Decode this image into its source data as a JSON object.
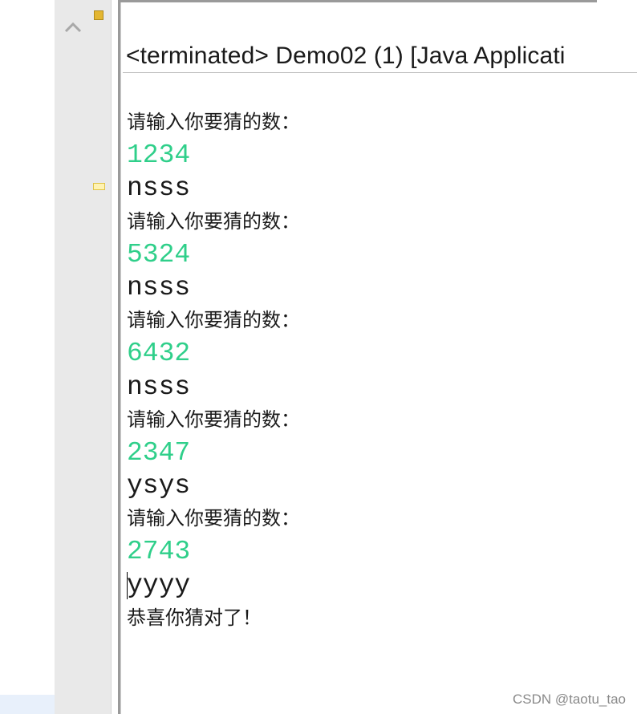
{
  "console": {
    "title": "<terminated> Demo02 (1) [Java Applicati",
    "lines": [
      {
        "kind": "prompt",
        "text": "请输入你要猜的数："
      },
      {
        "kind": "input",
        "text": "1234"
      },
      {
        "kind": "result",
        "text": "nsss"
      },
      {
        "kind": "prompt",
        "text": "请输入你要猜的数："
      },
      {
        "kind": "input",
        "text": "5324"
      },
      {
        "kind": "result",
        "text": "nsss"
      },
      {
        "kind": "prompt",
        "text": "请输入你要猜的数："
      },
      {
        "kind": "input",
        "text": "6432"
      },
      {
        "kind": "result",
        "text": "nsss"
      },
      {
        "kind": "prompt",
        "text": "请输入你要猜的数："
      },
      {
        "kind": "input",
        "text": "2347"
      },
      {
        "kind": "result",
        "text": "ysys"
      },
      {
        "kind": "prompt",
        "text": "请输入你要猜的数："
      },
      {
        "kind": "input",
        "text": "2743"
      },
      {
        "kind": "result",
        "text": "yyyy"
      },
      {
        "kind": "prompt",
        "text": "恭喜你猜对了！"
      }
    ]
  },
  "colors": {
    "input_text": "#2fcf8a",
    "output_text": "#1a1a1a",
    "marker": "#e3b631"
  },
  "icons": {
    "collapse": "chevron-up-icon"
  },
  "watermark": "CSDN @taotu_tao"
}
